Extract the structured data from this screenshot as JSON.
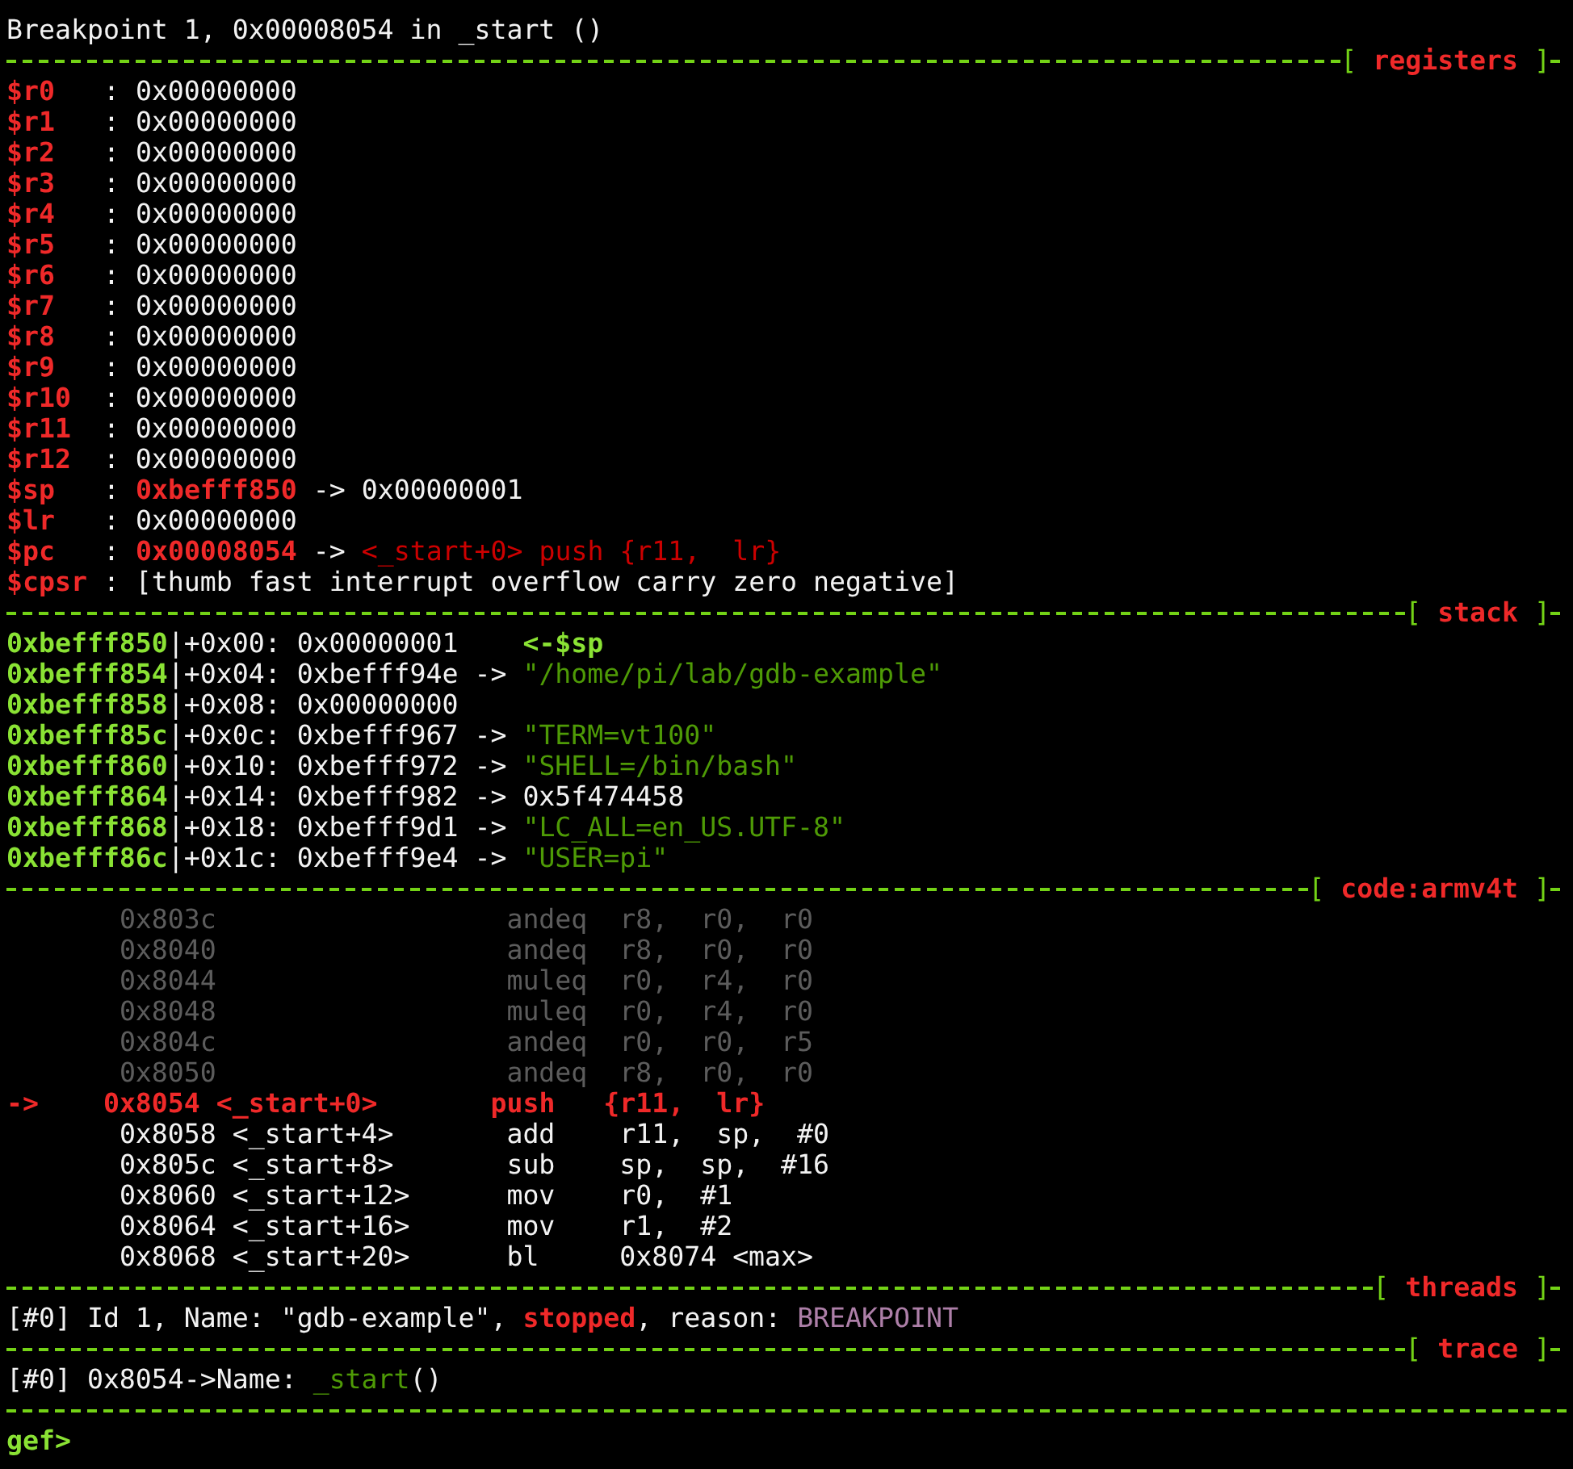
{
  "lines": [
    {
      "kind": "text",
      "segments": [
        {
          "text": "Breakpoint 1, 0x00008054 in _start ()",
          "kind": "plain"
        }
      ]
    },
    {
      "kind": "separator",
      "open": "[",
      "title": "registers",
      "close": "]"
    },
    {
      "kind": "text",
      "segments": [
        {
          "text": "$r0",
          "kind": "reg"
        },
        {
          "text": "   : 0x00000000",
          "kind": "plain"
        }
      ]
    },
    {
      "kind": "text",
      "segments": [
        {
          "text": "$r1",
          "kind": "reg"
        },
        {
          "text": "   : 0x00000000",
          "kind": "plain"
        }
      ]
    },
    {
      "kind": "text",
      "segments": [
        {
          "text": "$r2",
          "kind": "reg"
        },
        {
          "text": "   : 0x00000000",
          "kind": "plain"
        }
      ]
    },
    {
      "kind": "text",
      "segments": [
        {
          "text": "$r3",
          "kind": "reg"
        },
        {
          "text": "   : 0x00000000",
          "kind": "plain"
        }
      ]
    },
    {
      "kind": "text",
      "segments": [
        {
          "text": "$r4",
          "kind": "reg"
        },
        {
          "text": "   : 0x00000000",
          "kind": "plain"
        }
      ]
    },
    {
      "kind": "text",
      "segments": [
        {
          "text": "$r5",
          "kind": "reg"
        },
        {
          "text": "   : 0x00000000",
          "kind": "plain"
        }
      ]
    },
    {
      "kind": "text",
      "segments": [
        {
          "text": "$r6",
          "kind": "reg"
        },
        {
          "text": "   : 0x00000000",
          "kind": "plain"
        }
      ]
    },
    {
      "kind": "text",
      "segments": [
        {
          "text": "$r7",
          "kind": "reg"
        },
        {
          "text": "   : 0x00000000",
          "kind": "plain"
        }
      ]
    },
    {
      "kind": "text",
      "segments": [
        {
          "text": "$r8",
          "kind": "reg"
        },
        {
          "text": "   : 0x00000000",
          "kind": "plain"
        }
      ]
    },
    {
      "kind": "text",
      "segments": [
        {
          "text": "$r9",
          "kind": "reg"
        },
        {
          "text": "   : 0x00000000",
          "kind": "plain"
        }
      ]
    },
    {
      "kind": "text",
      "segments": [
        {
          "text": "$r10",
          "kind": "reg"
        },
        {
          "text": "  : 0x00000000",
          "kind": "plain"
        }
      ]
    },
    {
      "kind": "text",
      "segments": [
        {
          "text": "$r11",
          "kind": "reg"
        },
        {
          "text": "  : 0x00000000",
          "kind": "plain"
        }
      ]
    },
    {
      "kind": "text",
      "segments": [
        {
          "text": "$r12",
          "kind": "reg"
        },
        {
          "text": "  : 0x00000000",
          "kind": "plain"
        }
      ]
    },
    {
      "kind": "text",
      "segments": [
        {
          "text": "$sp",
          "kind": "reg"
        },
        {
          "text": "   :",
          "kind": "plain"
        },
        {
          "text": " 0xbefff850",
          "kind": "changed"
        },
        {
          "text": " -> 0x00000001",
          "kind": "plain"
        }
      ]
    },
    {
      "kind": "text",
      "segments": [
        {
          "text": "$lr",
          "kind": "reg"
        },
        {
          "text": "   : 0x00000000",
          "kind": "plain"
        }
      ]
    },
    {
      "kind": "text",
      "segments": [
        {
          "text": "$pc",
          "kind": "reg"
        },
        {
          "text": "   :",
          "kind": "plain"
        },
        {
          "text": " 0x00008054",
          "kind": "changed"
        },
        {
          "text": " ->",
          "kind": "plain"
        },
        {
          "text": " <_start+0> push {r11,  lr}",
          "kind": "code_ref"
        }
      ]
    },
    {
      "kind": "text",
      "segments": [
        {
          "text": "$cpsr",
          "kind": "reg"
        },
        {
          "text": " : [thumb fast interrupt overflow carry zero negative]",
          "kind": "plain"
        }
      ]
    },
    {
      "kind": "separator",
      "open": "[",
      "title": "stack",
      "close": "]"
    },
    {
      "kind": "text",
      "segments": [
        {
          "text": "0xbefff850",
          "kind": "stack_addr"
        },
        {
          "text": "|+0x00: 0x00000001",
          "kind": "plain"
        },
        {
          "text": "    <-$sp",
          "kind": "sp_marker"
        }
      ]
    },
    {
      "kind": "text",
      "segments": [
        {
          "text": "0xbefff854",
          "kind": "stack_addr"
        },
        {
          "text": "|+0x04: 0xbefff94e ->",
          "kind": "plain"
        },
        {
          "text": " \"/home/pi/lab/gdb-example\"",
          "kind": "string"
        }
      ]
    },
    {
      "kind": "text",
      "segments": [
        {
          "text": "0xbefff858",
          "kind": "stack_addr"
        },
        {
          "text": "|+0x08: 0x00000000",
          "kind": "plain"
        }
      ]
    },
    {
      "kind": "text",
      "segments": [
        {
          "text": "0xbefff85c",
          "kind": "stack_addr"
        },
        {
          "text": "|+0x0c: 0xbefff967 ->",
          "kind": "plain"
        },
        {
          "text": " \"TERM=vt100\"",
          "kind": "string"
        }
      ]
    },
    {
      "kind": "text",
      "segments": [
        {
          "text": "0xbefff860",
          "kind": "stack_addr"
        },
        {
          "text": "|+0x10: 0xbefff972 ->",
          "kind": "plain"
        },
        {
          "text": " \"SHELL=/bin/bash\"",
          "kind": "string"
        }
      ]
    },
    {
      "kind": "text",
      "segments": [
        {
          "text": "0xbefff864",
          "kind": "stack_addr"
        },
        {
          "text": "|+0x14: 0xbefff982 -> 0x5f474458",
          "kind": "plain"
        }
      ]
    },
    {
      "kind": "text",
      "segments": [
        {
          "text": "0xbefff868",
          "kind": "stack_addr"
        },
        {
          "text": "|+0x18: 0xbefff9d1 ->",
          "kind": "plain"
        },
        {
          "text": " \"LC_ALL=en_US.UTF-8\"",
          "kind": "string"
        }
      ]
    },
    {
      "kind": "text",
      "segments": [
        {
          "text": "0xbefff86c",
          "kind": "stack_addr"
        },
        {
          "text": "|+0x1c: 0xbefff9e4 ->",
          "kind": "plain"
        },
        {
          "text": " \"USER=pi\"",
          "kind": "string"
        }
      ]
    },
    {
      "kind": "separator",
      "open": "[",
      "title": "code:armv4t",
      "close": "]"
    },
    {
      "kind": "text",
      "segments": [
        {
          "text": "       0x803c                  andeq  r8,  r0,  r0",
          "kind": "dim"
        }
      ]
    },
    {
      "kind": "text",
      "segments": [
        {
          "text": "       0x8040                  andeq  r8,  r0,  r0",
          "kind": "dim"
        }
      ]
    },
    {
      "kind": "text",
      "segments": [
        {
          "text": "       0x8044                  muleq  r0,  r4,  r0",
          "kind": "dim"
        }
      ]
    },
    {
      "kind": "text",
      "segments": [
        {
          "text": "       0x8048                  muleq  r0,  r4,  r0",
          "kind": "dim"
        }
      ]
    },
    {
      "kind": "text",
      "segments": [
        {
          "text": "       0x804c                  andeq  r0,  r0,  r5",
          "kind": "dim"
        }
      ]
    },
    {
      "kind": "text",
      "segments": [
        {
          "text": "       0x8050                  andeq  r8,  r0,  r0",
          "kind": "dim"
        }
      ]
    },
    {
      "kind": "text",
      "segments": [
        {
          "text": "->",
          "kind": "current_arrow"
        },
        {
          "text": "    0x8054 <_start+0>       push   {r11,  lr}",
          "kind": "current"
        }
      ]
    },
    {
      "kind": "text",
      "segments": [
        {
          "text": "       0x8058 <_start+4>       add    r11,  sp,  #0",
          "kind": "code"
        }
      ]
    },
    {
      "kind": "text",
      "segments": [
        {
          "text": "       0x805c <_start+8>       sub    sp,  sp,  #16",
          "kind": "code"
        }
      ]
    },
    {
      "kind": "text",
      "segments": [
        {
          "text": "       0x8060 <_start+12>      mov    r0,  #1",
          "kind": "code"
        }
      ]
    },
    {
      "kind": "text",
      "segments": [
        {
          "text": "       0x8064 <_start+16>      mov    r1,  #2",
          "kind": "code"
        }
      ]
    },
    {
      "kind": "text",
      "segments": [
        {
          "text": "       0x8068 <_start+20>      bl     0x8074 <max>",
          "kind": "code"
        }
      ]
    },
    {
      "kind": "separator",
      "open": "[",
      "title": "threads",
      "close": "]"
    },
    {
      "kind": "text",
      "segments": [
        {
          "text": "[#0] Id 1, Name: \"gdb-example\",",
          "kind": "plain"
        },
        {
          "text": " stopped",
          "kind": "stopped"
        },
        {
          "text": ", reason:",
          "kind": "plain"
        },
        {
          "text": " BREAKPOINT",
          "kind": "reason"
        }
      ]
    },
    {
      "kind": "separator",
      "open": "[",
      "title": "trace",
      "close": "]"
    },
    {
      "kind": "text",
      "segments": [
        {
          "text": "[#0] 0x8054->Name:",
          "kind": "plain"
        },
        {
          "text": " _start",
          "kind": "func"
        },
        {
          "text": "()",
          "kind": "plain"
        }
      ]
    },
    {
      "kind": "separator"
    },
    {
      "kind": "text",
      "segments": [
        {
          "text": "gef>",
          "kind": "prompt"
        }
      ]
    }
  ]
}
